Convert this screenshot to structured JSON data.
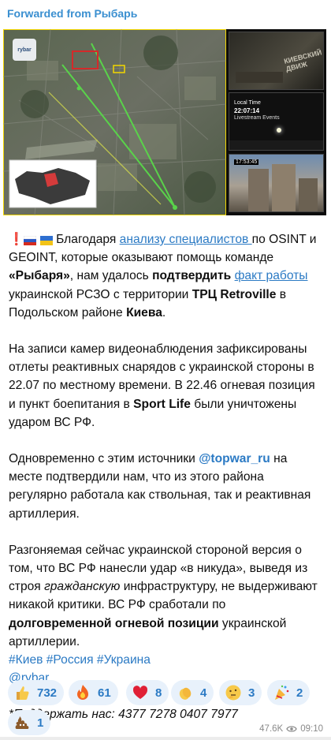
{
  "header": {
    "forwarded_from": "Forwarded from Рыбарь"
  },
  "media": {
    "map_logo": "rybar",
    "cam1_overlay": "КИЕВСКИЙ ДВИЖ",
    "cam2_label": "Local Time",
    "cam2_time": "22:07:14",
    "cam2_caption": "Livestream Events",
    "cam3_time": "17:53:45"
  },
  "message": {
    "p1_pre": "Благодаря ",
    "p1_link1": "анализу специалистов ",
    "p1_mid1": "по OSINT и GEOINT, которые оказывают помощь команде ",
    "p1_b1": "«Рыбаря»",
    "p1_mid2": ", нам удалось ",
    "p1_b2": "подтвердить",
    "p1_sp": " ",
    "p1_link2": "факт работы",
    "p1_mid3": " украинской РСЗО с территории ",
    "p1_b3": "ТРЦ Retroville",
    "p1_mid4": " в Подольском районе ",
    "p1_b4": "Киева",
    "p1_end": ".",
    "p2_pre": "На записи камер видеонаблюдения зафиксированы отлеты реактивных снарядов с украинской стороны в 22.07 по местному времени. В 22.46 огневая позиция и пункт боепитания в ",
    "p2_b1": "Sport Life",
    "p2_end": " были уничтожены ударом ВС РФ.",
    "p3_pre": "Одновременно с этим источники ",
    "p3_link": "@topwar_ru",
    "p3_end": " на месте подтвердили нам, что из этого района регулярно работала как ствольная, так и реактивная артиллерия.",
    "p4_pre": "Разгоняемая сейчас украинской стороной версия о том, что ВС РФ нанесли удар «в никуда», выведя из строя ",
    "p4_i": "гражданскую",
    "p4_mid": " инфраструктуру, не выдерживают никакой критики. ВС РФ сработали по ",
    "p4_b": "долговременной огневой позиции",
    "p4_end": " украинской артиллерии.",
    "hashtags": "#Киев #Россия #Украина",
    "handle": "@rybar",
    "donate": "*Поддержать нас: 4377 7278 0407 7977"
  },
  "reactions": [
    {
      "icon": "thumbs-up-icon",
      "count": "732"
    },
    {
      "icon": "fire-icon",
      "count": "61"
    },
    {
      "icon": "heart-icon",
      "count": "8"
    },
    {
      "icon": "clap-icon",
      "count": "4"
    },
    {
      "icon": "thinking-face-icon",
      "count": "3"
    },
    {
      "icon": "party-popper-icon",
      "count": "2"
    },
    {
      "icon": "poop-icon",
      "count": "1"
    }
  ],
  "meta": {
    "views": "47.6K",
    "time": "09:10"
  },
  "colors": {
    "link": "#2b7ac4",
    "reaction_bg": "#e8f1fb",
    "sender": "#3a8fd0"
  }
}
